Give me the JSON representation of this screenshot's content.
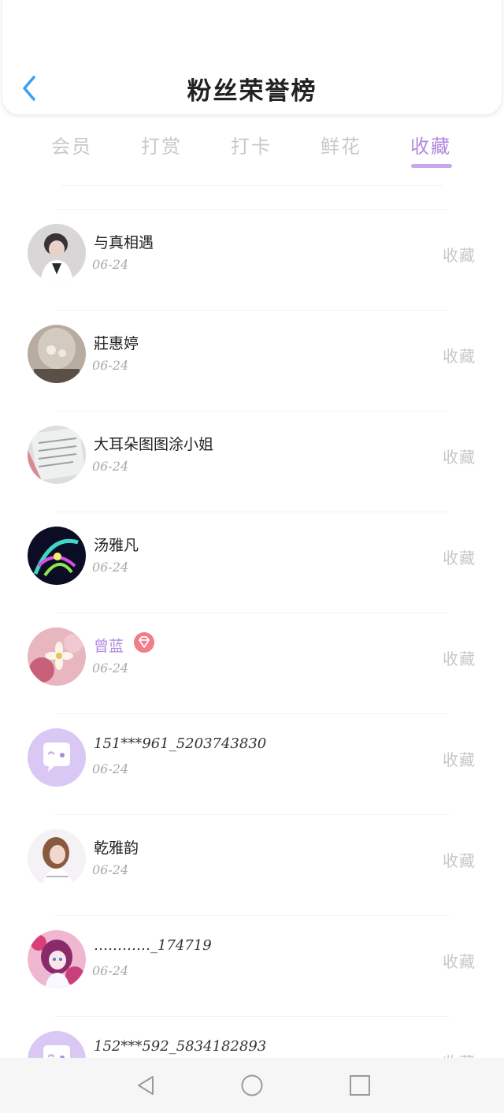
{
  "header": {
    "title": "粉丝荣誉榜"
  },
  "tabs": [
    {
      "label": "会员"
    },
    {
      "label": "打赏"
    },
    {
      "label": "打卡"
    },
    {
      "label": "鲜花"
    },
    {
      "label": "收藏"
    }
  ],
  "active_tab": "收藏",
  "colors": {
    "accent": "#b288e0",
    "vip_badge": "#ef7e88",
    "back_arrow": "#3aa0ef"
  },
  "fans": [
    {
      "name": "与真相遇",
      "date": "06-24",
      "action": "收藏",
      "avatar": "photo-boy"
    },
    {
      "name": "莊惠婷",
      "date": "06-24",
      "action": "收藏",
      "avatar": "photo-dome"
    },
    {
      "name": "大耳朵图图涂小姐",
      "date": "06-24",
      "action": "收藏",
      "avatar": "photo-paper"
    },
    {
      "name": "汤雅凡",
      "date": "06-24",
      "action": "收藏",
      "avatar": "photo-neon"
    },
    {
      "name": "曾蓝",
      "date": "06-24",
      "action": "收藏",
      "avatar": "photo-flower",
      "vip": true
    },
    {
      "name": "151***961_5203743830",
      "date": "06-24",
      "action": "收藏",
      "avatar": "default-chat-icon"
    },
    {
      "name": "乾雅韵",
      "date": "06-24",
      "action": "收藏",
      "avatar": "photo-girl"
    },
    {
      "name": "…………_174719",
      "date": "06-24",
      "action": "收藏",
      "avatar": "photo-anime"
    },
    {
      "name": "152***592_5834182893",
      "date": "",
      "action": "收藏",
      "avatar": "default-chat-icon"
    }
  ],
  "navbar": {
    "buttons": [
      "back-triangle-icon",
      "home-circle-icon",
      "recents-square-icon"
    ]
  }
}
